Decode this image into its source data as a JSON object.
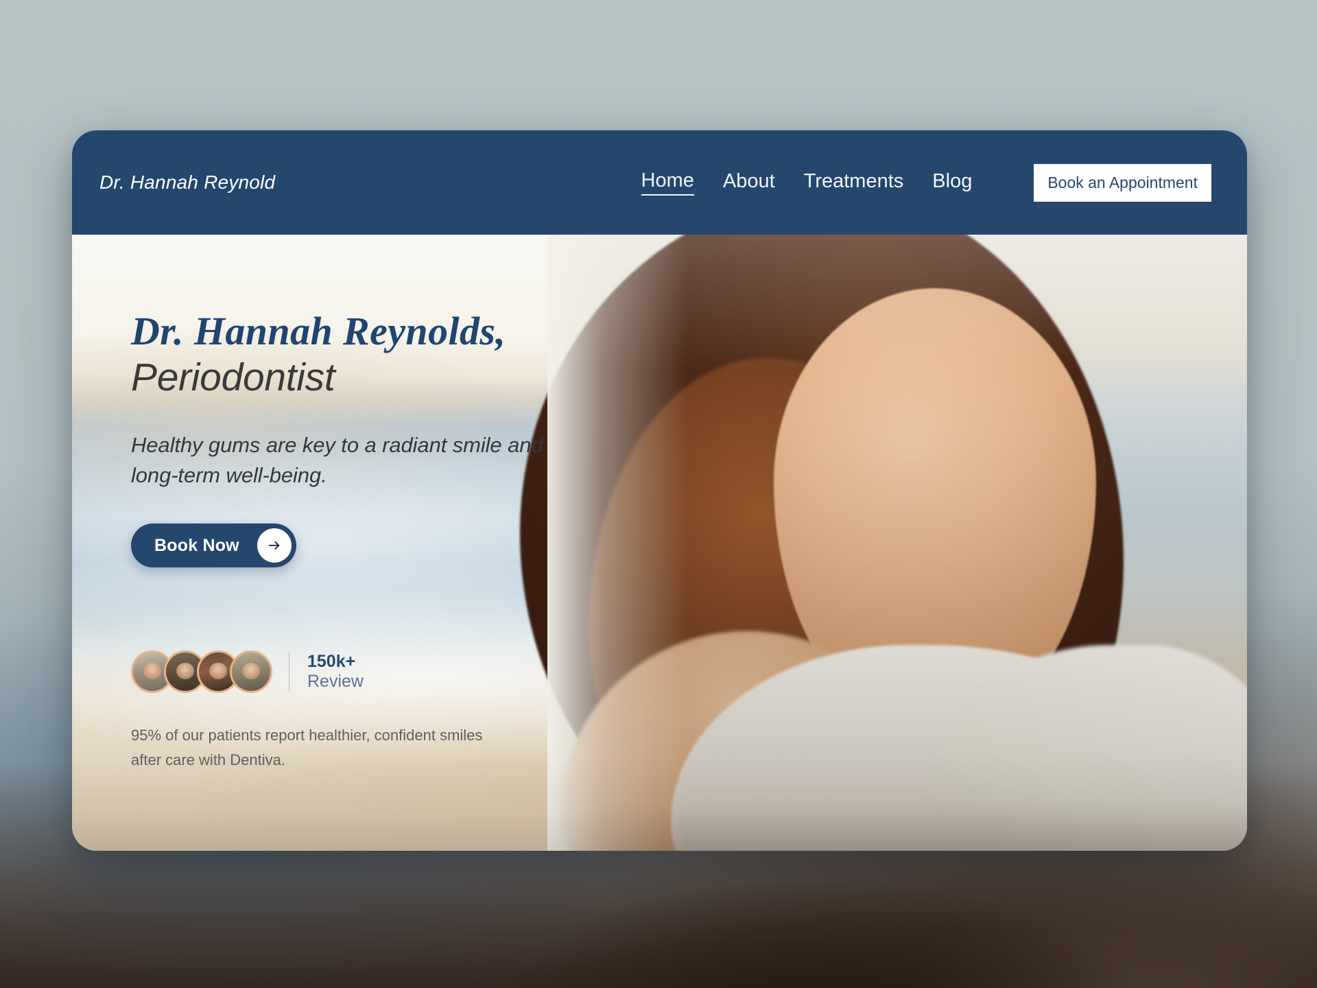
{
  "theme": {
    "navy": "#25476e",
    "headline_blue": "#1f4570",
    "page_bg": "#b4c2c4",
    "avatar_ring": "#e7b189",
    "review_label_color": "#5d7390"
  },
  "header": {
    "logo": "Dr. Hannah Reynold",
    "nav": [
      {
        "label": "Home",
        "active": true
      },
      {
        "label": "About",
        "active": false
      },
      {
        "label": "Treatments",
        "active": false
      },
      {
        "label": "Blog",
        "active": false
      }
    ],
    "cta_label": "Book an Appointment"
  },
  "hero": {
    "headline_script": "Dr. Hannah Reynolds,",
    "headline_sub": "Periodontist",
    "lede": "Healthy gums are key to a radiant smile and long-term well-being.",
    "book_now_label": "Book Now",
    "book_now_icon": "arrow-right-icon",
    "reviews": {
      "count": "150k+",
      "label": "Review",
      "avatar_count": 4
    },
    "footnote": "95% of our patients report healthier, confident smiles after care with Dentiva."
  }
}
